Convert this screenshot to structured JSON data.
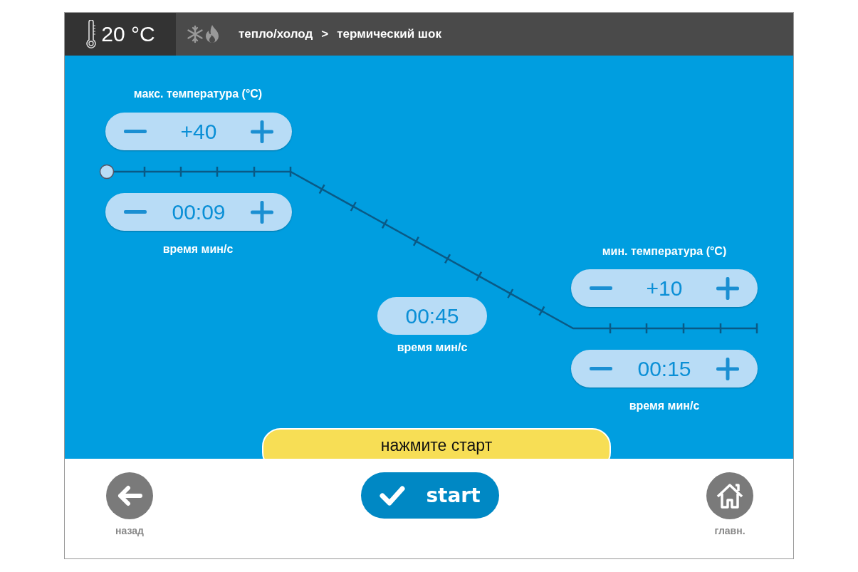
{
  "header": {
    "room_temperature": "20 °C",
    "breadcrumb": [
      "тепло/холод",
      ">",
      "термический шок"
    ]
  },
  "profile": {
    "max_temperature": {
      "label": "макс. температура  (°C)",
      "value": "+40"
    },
    "max_time": {
      "label": "время мин/с",
      "value": "00:09"
    },
    "ramp_time": {
      "label": "время мин/с",
      "value": "00:45"
    },
    "min_temperature": {
      "label": "мин. температура (°C)",
      "value": "+10"
    },
    "min_time": {
      "label": "время мин/с",
      "value": "00:15"
    }
  },
  "hint": "нажмите старт",
  "footer": {
    "back": "назад",
    "start": "start",
    "home": "главн."
  }
}
